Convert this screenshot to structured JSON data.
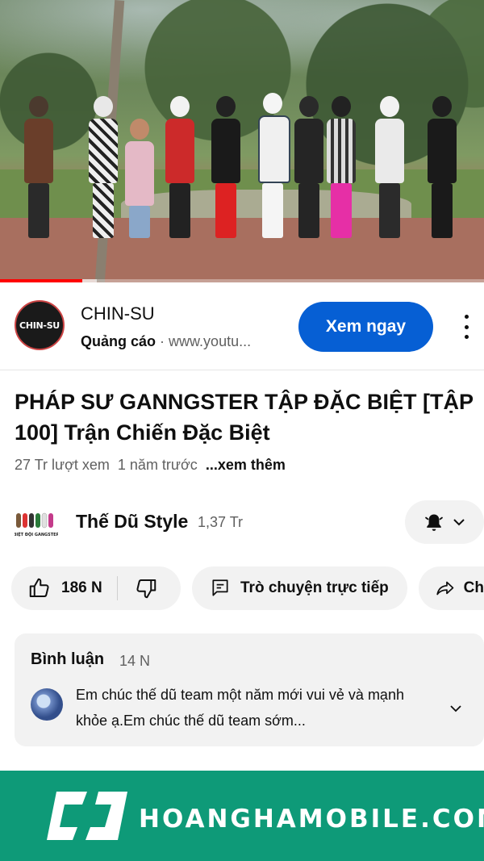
{
  "video": {
    "progress_percent": 17,
    "buffered_percent": 20
  },
  "ad": {
    "logo_text": "CHIN-SU",
    "name": "CHIN-SU",
    "label": "Quảng cáo",
    "separator": "·",
    "url": "www.youtu...",
    "cta": "Xem ngay"
  },
  "video_info": {
    "title": "PHÁP SƯ GANNGSTER TẬP ĐẶC BIỆT [TẬP 100] Trận Chiến Đặc Biệt",
    "views": "27 Tr lượt xem",
    "age": "1 năm trước",
    "more": "...xem thêm"
  },
  "channel": {
    "avatar_caption": "BIỆT ĐỘI GANGSTER",
    "name": "Thế Dũ Style",
    "subscribers": "1,37 Tr"
  },
  "actions": {
    "likes": "186 N",
    "chat": "Trò chuyện trực tiếp",
    "share_partial": "Ch"
  },
  "comments": {
    "header": "Bình luận",
    "count": "14 N",
    "top_comment": "Em chúc thế dũ team một năm mới vui vẻ và mạnh khỏe ạ.Em chúc thế dũ team sớm..."
  },
  "banner": {
    "brand": "HOANGHAMOBILE.COM"
  },
  "colors": {
    "cta_blue": "#065fd4",
    "progress_red": "#ff0000",
    "banner_green": "#0e9a78"
  }
}
